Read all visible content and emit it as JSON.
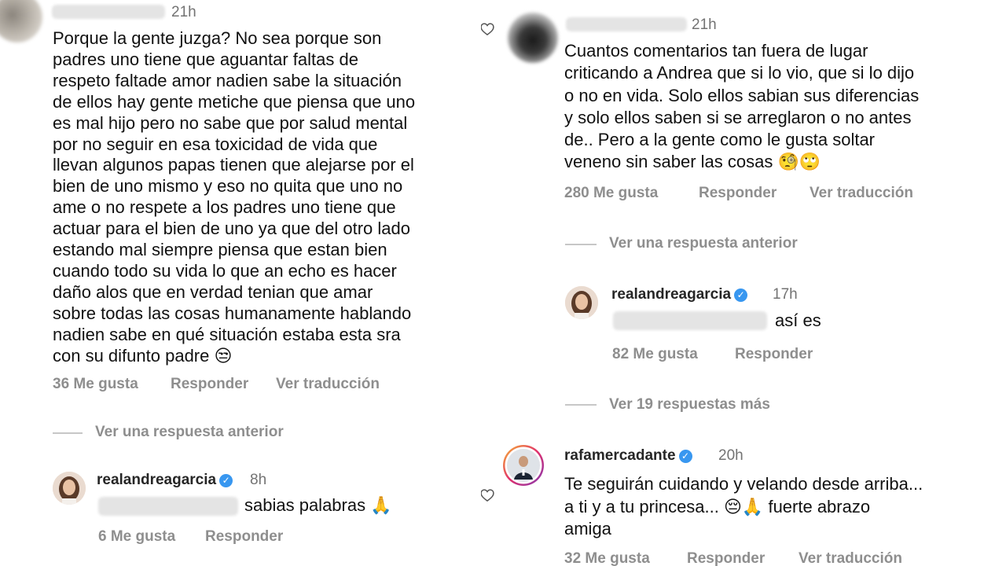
{
  "left": {
    "comment": {
      "time": "21h",
      "text": "Porque la gente juzga? No sea porque son\npadres uno tiene que aguantar faltas de\nrespeto faltade amor nadien sabe la situación\nde ellos hay gente metiche que piensa que uno\nes mal hijo pero no sabe que por salud mental\npor no seguir en esa toxicidad de vida que\nllevan algunos papas tienen que  alejarse por el\nbien de uno mismo y eso no quita que uno no\name o no respete a los padres uno tiene que\nactuar para el bien de uno ya que del otro lado\nestando mal siempre piensa que estan bien\ncuando todo su vida lo que an echo es hacer\ndaño alos que en verdad tenian que amar\nsobre todas las cosas humanamente hablando\nnadien sabe en qué situación estaba esta sra\ncon su difunto padre",
      "emoji": "😒",
      "likes": "36 Me gusta",
      "reply": "Responder",
      "translate": "Ver traducción",
      "view_previous": "Ver una respuesta anterior"
    },
    "reply": {
      "username": "realandreagarcia",
      "time": "8h",
      "text": "sabias palabras",
      "emoji": "🙏",
      "likes": "6 Me gusta",
      "reply": "Responder"
    }
  },
  "right": {
    "comment": {
      "time": "21h",
      "text": "Cuantos comentarios tan fuera de lugar\ncriticando a Andrea que si lo vio, que si lo dijo\no no en vida. Solo ellos sabian sus diferencias\ny solo ellos saben si se arreglaron o no antes\nde.. Pero a la gente como le gusta soltar\nveneno sin saber las cosas",
      "emoji": "🧐🙄",
      "likes": "280 Me gusta",
      "reply": "Responder",
      "translate": "Ver traducción",
      "view_previous": "Ver una respuesta anterior"
    },
    "reply": {
      "username": "realandreagarcia",
      "time": "17h",
      "text": "así es",
      "likes": "82 Me gusta",
      "reply": "Responder",
      "view_more": "Ver 19 respuestas más"
    },
    "comment2": {
      "username": "rafamercadante",
      "time": "20h",
      "text_line1": "Te seguirán cuidando y velando desde arriba...",
      "text_line2a": "a ti y a tu princesa...",
      "emoji": "😔🙏",
      "text_line2b": "fuerte abrazo",
      "text_line3": "amiga",
      "likes": "32 Me gusta",
      "reply": "Responder",
      "translate": "Ver traducción"
    }
  },
  "icons": {
    "verified": "verified-badge-icon",
    "heart": "heart-outline-icon",
    "verified_glyph": "✓"
  },
  "colors": {
    "secondary_text": "#8e8e8e",
    "verified_blue": "#3897f0",
    "divider": "#c7c7c7"
  }
}
